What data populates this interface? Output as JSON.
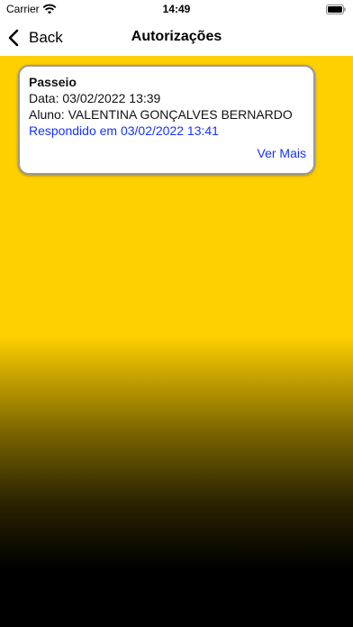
{
  "status_bar": {
    "carrier": "Carrier",
    "time": "14:49"
  },
  "nav": {
    "back_label": "Back",
    "title": "Autorizações"
  },
  "authorizations": [
    {
      "title": "Passeio",
      "date_line": "Data: 03/02/2022 13:39",
      "student_line": "Aluno: VALENTINA GONÇALVES BERNARDO",
      "status_line": "Respondido em 03/02/2022 13:41",
      "more_label": "Ver Mais"
    }
  ],
  "colors": {
    "background_top": "#ffd000",
    "background_bottom": "#000000",
    "link": "#1533ff"
  },
  "icons": {
    "back": "chevron-left-icon",
    "wifi": "wifi-icon",
    "battery": "battery-icon"
  }
}
